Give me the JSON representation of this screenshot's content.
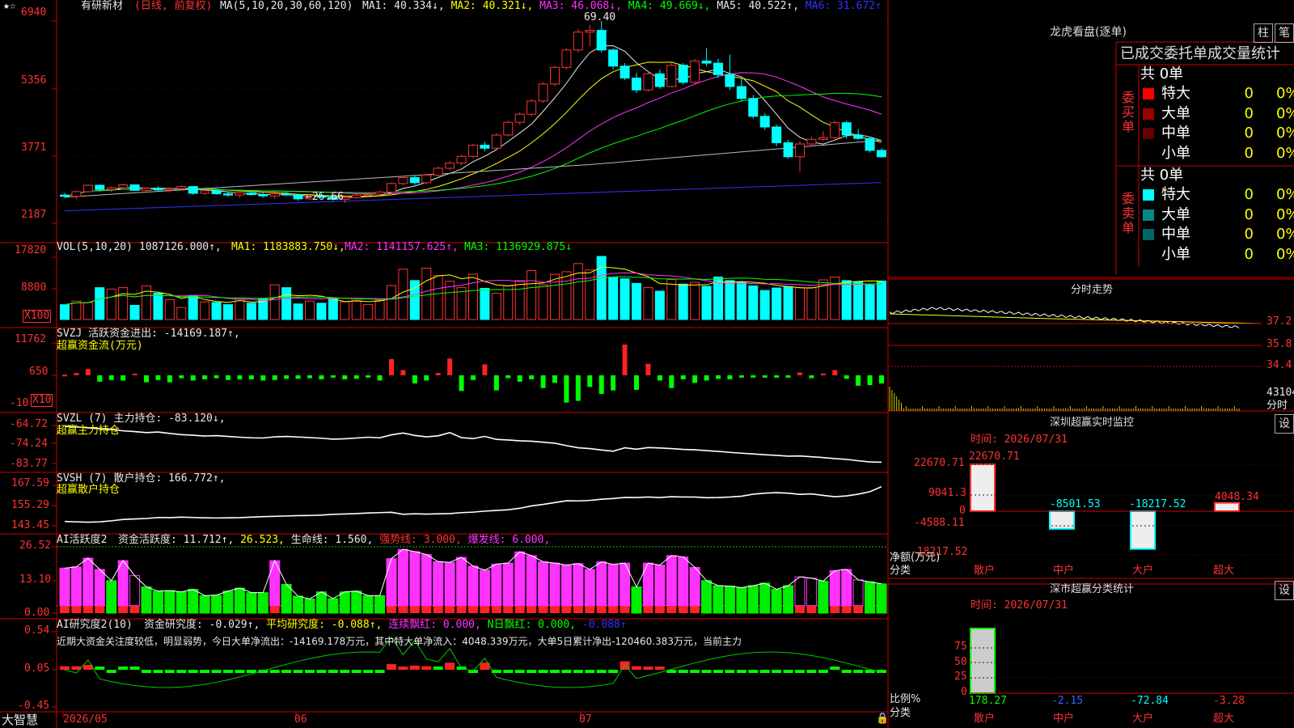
{
  "stock": {
    "name": "有研新材",
    "mode": "(日线, 前复权)"
  },
  "main": {
    "ma_label": "MA(5,10,20,30,60,120)",
    "ma": [
      {
        "text": "MA1: 40.334↓,",
        "color": "#e8e8e8"
      },
      {
        "text": "MA2: 40.321↓,",
        "color": "#ffff00"
      },
      {
        "text": "MA3: 46.068↓,",
        "color": "#ff33ff"
      },
      {
        "text": "MA4: 49.669↓,",
        "color": "#00ff00"
      },
      {
        "text": "MA5: 40.522↑,",
        "color": "#e8e8e8"
      },
      {
        "text": "MA6: 31.672↑",
        "color": "#3333ff"
      }
    ],
    "yticks": [
      "6940",
      "5356",
      "3771",
      "2187"
    ],
    "high_mark": "69.40",
    "low_mark": "←26.66"
  },
  "vol": {
    "label": "VOL(5,10,20)",
    "value": "1087126.000↑,",
    "ma1": "MA1: 1183883.750↓,",
    "ma2": "MA2: 1141157.625↑,",
    "ma3": "MA3: 1136929.875↓",
    "yticks": [
      "17820",
      "8800"
    ],
    "unit": "X100"
  },
  "svzj": {
    "label": "SVZJ  活跃资金进出: -14169.187↑,",
    "sub": "超赢资金流(万元)",
    "yticks": [
      "11762",
      "650",
      "-10"
    ],
    "unit": "X10"
  },
  "svzl": {
    "label": "SVZL (7) 主力持仓: -83.120↓,",
    "sub": "超赢主力持仓",
    "yticks": [
      "-64.72",
      "-74.24",
      "-83.77"
    ]
  },
  "svsh": {
    "label": "SVSH (7) 散户持仓: 166.772↑,",
    "sub": "超赢散户持仓",
    "yticks": [
      "167.59",
      "155.29",
      "143.45"
    ]
  },
  "ai1": {
    "title": "AI活跃度2",
    "items": [
      {
        "text": "资金活跃度: 11.712↑,",
        "color": "#e8e8e8"
      },
      {
        "text": "26.523,",
        "color": "#ffff00"
      },
      {
        "text": "生命线: 1.560,",
        "color": "#e8e8e8"
      },
      {
        "text": "强势线: 3.000,",
        "color": "#ff3333"
      },
      {
        "text": "爆发线: 6.000,",
        "color": "#ff33ff"
      }
    ],
    "yticks": [
      "26.52",
      "13.10",
      "0.00"
    ]
  },
  "ai2": {
    "title": "AI研究度2(10)",
    "items": [
      {
        "text": "资金研究度: -0.029↑,",
        "color": "#e8e8e8"
      },
      {
        "text": "平均研究度: -0.088↑,",
        "color": "#ffff00"
      },
      {
        "text": "连续飘红: 0.000,",
        "color": "#ff33ff"
      },
      {
        "text": "N日飘红: 0.000,",
        "color": "#00ff00"
      },
      {
        "text": "-0.088↑",
        "color": "#3333ff"
      }
    ],
    "comment": "近期大资金关注度较低，明显弱势，今日大单净流出：-14169.178万元，其中特大单净流入：4048.339万元，大单5日累计净出-120460.383万元，当前主力",
    "yticks": [
      "0.54",
      "0.05",
      "-0.45"
    ]
  },
  "xaxis": {
    "brand": "大智慧",
    "labels": [
      "2026/05",
      "06",
      "07"
    ]
  },
  "lhb": {
    "title": "龙虎看盘(逐单)",
    "btn1": "柱",
    "btn2": "笔",
    "tab": "已成交委托单成交量统计",
    "buy": {
      "side": "委买单",
      "total": "共 0单",
      "rows": [
        {
          "name": "特大",
          "count": "0",
          "pct": "0%",
          "color": "#ff0000"
        },
        {
          "name": "大单",
          "count": "0",
          "pct": "0%",
          "color": "#990000"
        },
        {
          "name": "中单",
          "count": "0",
          "pct": "0%",
          "color": "#660000"
        },
        {
          "name": "小单",
          "count": "0",
          "pct": "0%",
          "color": ""
        }
      ]
    },
    "sell": {
      "side": "委卖单",
      "total": "共 0单",
      "rows": [
        {
          "name": "特大",
          "count": "0",
          "pct": "0%",
          "color": "#00ffff"
        },
        {
          "name": "大单",
          "count": "0",
          "pct": "0%",
          "color": "#008888"
        },
        {
          "name": "中单",
          "count": "0",
          "pct": "0%",
          "color": "#006666"
        },
        {
          "name": "小单",
          "count": "0",
          "pct": "0%",
          "color": ""
        }
      ]
    }
  },
  "intraday": {
    "title": "分时走势",
    "prices": [
      "37.2",
      "35.8",
      "34.4"
    ],
    "vol": "43104",
    "unit": "分时"
  },
  "monitor": {
    "title": "深圳超赢实时监控",
    "btn": "设",
    "time": "时间: 2026/07/31",
    "yticks": [
      "22670.71",
      "9041.3",
      "0",
      "-4588.11",
      "-18217.52"
    ],
    "ylabel": "净额(万元)",
    "xlabel": "分类",
    "values_text": [
      "22670.71",
      "-8501.53",
      "-18217.52",
      "4048.34"
    ],
    "categories": [
      "散户",
      "中户",
      "大户",
      "超大"
    ]
  },
  "classify": {
    "title": "深市超赢分类统计",
    "btn": "设",
    "time": "时间: 2026/07/31",
    "yticks": [
      "75",
      "50",
      "25",
      "0"
    ],
    "ylabel": "比例%",
    "xlabel": "分类",
    "values_text": [
      "178.27",
      "-2.15",
      "-72.84",
      "-3.28"
    ],
    "categories": [
      "散户",
      "中户",
      "大户",
      "超大"
    ]
  },
  "chart_data": [
    {
      "type": "candlestick",
      "title": "有研新材 (日线, 前复权)",
      "x_range": [
        "2026/05",
        "2026/07"
      ],
      "ylim": [
        21.87,
        69.4
      ],
      "candles_ohlc": [
        [
          28.5,
          29.0,
          27.8,
          28.2
        ],
        [
          28.2,
          29.5,
          27.5,
          29.3
        ],
        [
          29.3,
          31.0,
          29.0,
          30.8
        ],
        [
          30.8,
          31.0,
          29.5,
          29.8
        ],
        [
          29.8,
          30.5,
          29.2,
          30.2
        ],
        [
          30.2,
          31.2,
          29.8,
          30.9
        ],
        [
          30.9,
          31.0,
          29.5,
          29.6
        ],
        [
          29.6,
          30.3,
          29.0,
          30.1
        ],
        [
          30.1,
          30.6,
          29.4,
          29.7
        ],
        [
          29.7,
          30.2,
          29.1,
          30.0
        ],
        [
          30.0,
          30.8,
          29.6,
          30.5
        ],
        [
          30.5,
          30.6,
          28.6,
          28.9
        ],
        [
          28.9,
          29.8,
          28.5,
          29.5
        ],
        [
          29.5,
          29.8,
          28.6,
          28.8
        ],
        [
          28.8,
          29.3,
          28.1,
          28.5
        ],
        [
          28.5,
          29.2,
          28.0,
          29.0
        ],
        [
          29.0,
          29.5,
          28.4,
          28.6
        ],
        [
          28.6,
          29.0,
          27.9,
          28.3
        ],
        [
          28.3,
          29.0,
          27.6,
          28.8
        ],
        [
          28.8,
          29.3,
          28.3,
          28.5
        ],
        [
          28.5,
          28.8,
          27.2,
          27.6
        ],
        [
          27.6,
          28.6,
          27.3,
          28.3
        ],
        [
          28.3,
          28.9,
          27.8,
          28.0
        ],
        [
          28.0,
          28.5,
          27.2,
          27.5
        ],
        [
          27.5,
          28.2,
          26.66,
          27.9
        ],
        [
          27.9,
          28.8,
          27.6,
          28.5
        ],
        [
          28.5,
          29.0,
          28.1,
          28.7
        ],
        [
          28.7,
          29.5,
          28.4,
          29.2
        ],
        [
          29.2,
          31.5,
          29.0,
          31.2
        ],
        [
          31.2,
          33.0,
          30.8,
          32.6
        ],
        [
          32.6,
          33.1,
          30.9,
          31.4
        ],
        [
          31.4,
          33.5,
          31.0,
          33.2
        ],
        [
          33.2,
          35.2,
          32.8,
          34.8
        ],
        [
          34.8,
          36.5,
          34.2,
          36.0
        ],
        [
          36.0,
          38.0,
          35.5,
          37.6
        ],
        [
          37.6,
          40.5,
          37.2,
          40.2
        ],
        [
          40.2,
          41.0,
          38.8,
          39.5
        ],
        [
          39.5,
          43.0,
          39.1,
          42.6
        ],
        [
          42.6,
          46.0,
          42.2,
          45.6
        ],
        [
          45.6,
          48.0,
          45.0,
          47.5
        ],
        [
          47.5,
          51.0,
          47.0,
          50.6
        ],
        [
          50.6,
          55.0,
          50.2,
          54.6
        ],
        [
          54.6,
          59.0,
          54.0,
          58.5
        ],
        [
          58.5,
          63.0,
          58.0,
          62.6
        ],
        [
          62.6,
          67.5,
          62.0,
          66.8
        ],
        [
          66.8,
          68.5,
          63.5,
          67.2
        ],
        [
          67.2,
          69.4,
          62.0,
          62.6
        ],
        [
          62.6,
          63.0,
          58.0,
          58.8
        ],
        [
          58.8,
          59.5,
          55.5,
          56.0
        ],
        [
          56.0,
          57.2,
          52.5,
          53.2
        ],
        [
          53.2,
          57.5,
          52.8,
          57.0
        ],
        [
          57.0,
          58.0,
          53.5,
          54.0
        ],
        [
          54.0,
          59.5,
          53.8,
          59.0
        ],
        [
          59.0,
          59.5,
          54.5,
          55.0
        ],
        [
          55.0,
          60.5,
          54.6,
          60.0
        ],
        [
          60.0,
          63.0,
          58.8,
          59.5
        ],
        [
          59.5,
          60.5,
          56.0,
          56.8
        ],
        [
          56.8,
          61.5,
          53.2,
          54.0
        ],
        [
          54.0,
          56.0,
          50.5,
          51.2
        ],
        [
          51.2,
          52.0,
          46.5,
          47.0
        ],
        [
          47.0,
          47.8,
          43.8,
          44.5
        ],
        [
          44.5,
          45.0,
          40.0,
          40.8
        ],
        [
          40.8,
          41.5,
          37.0,
          37.5
        ],
        [
          37.5,
          41.2,
          34.0,
          40.5
        ],
        [
          40.5,
          42.2,
          39.8,
          41.6
        ],
        [
          41.6,
          43.5,
          41.2,
          42.0
        ],
        [
          42.0,
          46.0,
          41.5,
          45.5
        ],
        [
          45.5,
          46.0,
          41.8,
          42.6
        ],
        [
          42.6,
          44.0,
          41.5,
          41.8
        ],
        [
          41.8,
          42.0,
          38.5,
          39.0
        ],
        [
          39.0,
          39.5,
          37.2,
          37.5
        ]
      ],
      "ma_last": {
        "MA1": 40.334,
        "MA2": 40.321,
        "MA3": 46.068,
        "MA4": 49.669,
        "MA5": 40.522,
        "MA6": 31.672
      }
    },
    {
      "type": "bar",
      "title": "VOL(5,10,20)",
      "unit": "X100",
      "ylim": [
        0,
        17820
      ],
      "values": [
        4200,
        5200,
        4800,
        9000,
        8600,
        9000,
        4000,
        9500,
        7400,
        5600,
        3400,
        6800,
        5000,
        4800,
        4200,
        6000,
        4600,
        5800,
        9800,
        9000,
        4400,
        5200,
        4600,
        6100,
        5000,
        5400,
        4200,
        5400,
        9600,
        14200,
        11000,
        14500,
        12400,
        10800,
        9000,
        12800,
        8800,
        7400,
        9500,
        11000,
        13800,
        9800,
        12800,
        13500,
        15800,
        14000,
        17820,
        12000,
        11500,
        10200,
        9000,
        8000,
        11300,
        10000,
        10500,
        9400,
        12000,
        11000,
        10600,
        9500,
        8200,
        8900,
        9300,
        9000,
        9000,
        11200,
        12000,
        11000,
        10700,
        9700,
        10870
      ]
    },
    {
      "type": "bar",
      "title": "SVZJ 活跃资金进出",
      "unit": "X10",
      "ylim": [
        -10,
        11762
      ],
      "values": [
        100,
        400,
        1100,
        -1100,
        -800,
        -900,
        300,
        -1200,
        -800,
        -1200,
        -500,
        -900,
        -700,
        -500,
        -800,
        -700,
        -700,
        -900,
        -800,
        -600,
        -600,
        -500,
        -700,
        -400,
        -700,
        -600,
        -400,
        -900,
        2800,
        900,
        -1400,
        -900,
        400,
        2900,
        -2700,
        -800,
        1900,
        -2600,
        -500,
        -1100,
        -700,
        -2200,
        -1300,
        -4700,
        -4400,
        -2000,
        -3200,
        -2600,
        5300,
        -2500,
        2000,
        -900,
        -2200,
        -700,
        -1300,
        -900,
        -600,
        -700,
        -400,
        -400,
        -400,
        -400,
        -400,
        500,
        -500,
        300,
        900,
        -600,
        -1800,
        -1700,
        -1417
      ]
    },
    {
      "type": "line",
      "title": "SVZL (7) 主力持仓",
      "ylim": [
        -83.77,
        -64.72
      ],
      "values": [
        -65.2,
        -65.4,
        -65.9,
        -66.3,
        -66.8,
        -67.4,
        -67.8,
        -68.3,
        -68.0,
        -68.7,
        -69.3,
        -69.6,
        -70.0,
        -69.8,
        -70.2,
        -70.6,
        -70.9,
        -71.0,
        -70.4,
        -70.2,
        -70.5,
        -70.8,
        -71.1,
        -71.6,
        -71.4,
        -71.0,
        -70.6,
        -70.9,
        -69.4,
        -68.5,
        -69.7,
        -70.4,
        -69.9,
        -68.3,
        -70.8,
        -71.3,
        -70.2,
        -71.7,
        -72.0,
        -72.4,
        -72.6,
        -73.1,
        -73.6,
        -74.8,
        -75.9,
        -76.3,
        -77.0,
        -77.6,
        -75.9,
        -76.6,
        -75.8,
        -76.0,
        -76.3,
        -76.7,
        -76.9,
        -77.3,
        -77.7,
        -78.2,
        -78.6,
        -79.0,
        -79.4,
        -79.7,
        -80.1,
        -80.0,
        -80.4,
        -80.8,
        -81.3,
        -81.7,
        -82.4,
        -83.0,
        -83.12
      ]
    },
    {
      "type": "line",
      "title": "SVSH (7) 散户持仓",
      "ylim": [
        143.45,
        167.59
      ],
      "values": [
        146.0,
        145.8,
        145.6,
        145.8,
        146.4,
        147.2,
        147.5,
        147.8,
        148.4,
        148.3,
        148.6,
        148.4,
        148.2,
        148.1,
        148.2,
        148.3,
        148.6,
        148.9,
        149.1,
        149.3,
        149.5,
        149.6,
        149.8,
        150.3,
        150.5,
        150.7,
        151.1,
        151.3,
        151.5,
        150.3,
        150.6,
        150.4,
        150.6,
        150.7,
        151.3,
        151.6,
        152.2,
        152.6,
        153.0,
        153.9,
        155.3,
        156.2,
        157.3,
        158.4,
        158.3,
        158.6,
        159.3,
        159.7,
        160.4,
        160.3,
        160.6,
        160.3,
        160.8,
        160.6,
        160.6,
        160.2,
        160.3,
        160.6,
        161.1,
        162.3,
        162.9,
        163.2,
        162.9,
        162.2,
        162.5,
        161.6,
        160.8,
        161.3,
        162.3,
        163.8,
        166.77
      ]
    },
    {
      "type": "bar",
      "title": "AI活跃度2 资金活跃度",
      "ylim": [
        0,
        26.52
      ],
      "values": [
        18.0,
        18.5,
        22.0,
        17.5,
        13.0,
        21.0,
        15.0,
        10.5,
        8.8,
        9.0,
        8.5,
        9.5,
        7.0,
        7.2,
        8.8,
        10.0,
        8.2,
        8.2,
        21.0,
        11.5,
        6.8,
        5.7,
        8.5,
        5.8,
        8.5,
        8.8,
        7.0,
        7.0,
        21.8,
        25.5,
        24.6,
        23.4,
        20.6,
        20.3,
        22.3,
        18.8,
        17.2,
        19.6,
        20.0,
        24.5,
        23.0,
        20.5,
        20.0,
        19.2,
        19.8,
        17.5,
        20.5,
        19.5,
        20.0,
        10.5,
        20.0,
        19.2,
        23.0,
        22.5,
        18.3,
        13.0,
        11.0,
        10.8,
        10.2,
        11.0,
        12.0,
        9.5,
        11.0,
        14.5,
        14.0,
        12.8,
        17.0,
        17.5,
        13.3,
        12.5,
        11.712
      ]
    },
    {
      "type": "bar",
      "title": "AI研究度2(10) 资金研究度",
      "ylim": [
        -0.45,
        0.54
      ],
      "values": [
        0.05,
        0.05,
        0.07,
        0.0,
        -0.02,
        0.0,
        0.0,
        -0.02,
        -0.02,
        -0.03,
        -0.02,
        -0.02,
        -0.02,
        -0.02,
        -0.02,
        -0.02,
        -0.02,
        -0.02,
        -0.02,
        -0.03,
        -0.02,
        -0.02,
        -0.02,
        -0.02,
        -0.02,
        -0.02,
        -0.02,
        -0.02,
        0.08,
        0.04,
        0.06,
        0.05,
        0.02,
        0.1,
        0.0,
        -0.02,
        0.1,
        -0.02,
        -0.02,
        -0.02,
        -0.02,
        -0.03,
        -0.03,
        -0.04,
        -0.04,
        -0.03,
        -0.03,
        -0.02,
        0.12,
        0.05,
        0.04,
        0.03,
        -0.02,
        -0.02,
        -0.02,
        -0.02,
        -0.02,
        -0.02,
        -0.02,
        -0.02,
        -0.02,
        -0.02,
        -0.02,
        -0.02,
        -0.02,
        -0.02,
        0.0,
        -0.03,
        -0.03,
        -0.03,
        -0.029
      ]
    },
    {
      "type": "bar",
      "title": "深圳超赢实时监控",
      "categories": [
        "散户",
        "中户",
        "大户",
        "超大"
      ],
      "values": [
        22670.71,
        -8501.53,
        -18217.52,
        4048.34
      ],
      "ylabel": "净额(万元)",
      "xlabel": "分类",
      "ylim": [
        -18217.52,
        22670.71
      ]
    },
    {
      "type": "bar",
      "title": "深市超赢分类统计",
      "categories": [
        "散户",
        "中户",
        "大户",
        "超大"
      ],
      "values": [
        178.27,
        -2.15,
        -72.84,
        -3.28
      ],
      "ylabel": "比例%",
      "xlabel": "分类",
      "ylim": [
        0,
        75
      ]
    }
  ]
}
